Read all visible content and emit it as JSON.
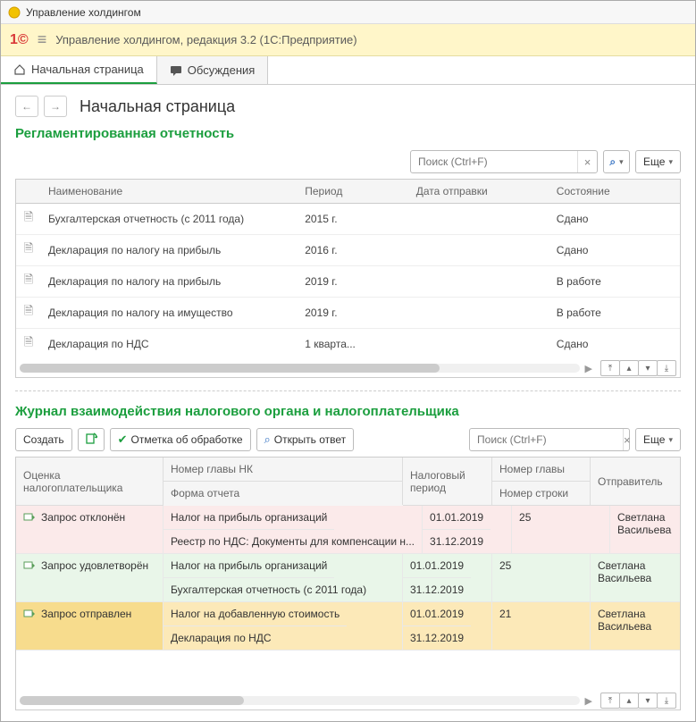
{
  "window_title": "Управление холдингом",
  "header_title": "Управление холдингом, редакция 3.2  (1С:Предприятие)",
  "tabs": {
    "home": "Начальная страница",
    "discussions": "Обсуждения"
  },
  "page_title": "Начальная страница",
  "section1": {
    "title": "Регламентированная отчетность",
    "search_placeholder": "Поиск (Ctrl+F)",
    "more_label": "Еще",
    "columns": {
      "name": "Наименование",
      "period": "Период",
      "sent_date": "Дата отправки",
      "status": "Состояние"
    },
    "rows": [
      {
        "name": "Бухгалтерская отчетность (с 2011 года)",
        "period": "2015 г.",
        "sent": "",
        "status": "Сдано"
      },
      {
        "name": "Декларация по налогу на прибыль",
        "period": "2016 г.",
        "sent": "",
        "status": "Сдано"
      },
      {
        "name": "Декларация по налогу на прибыль",
        "period": "2019 г.",
        "sent": "",
        "status": "В работе"
      },
      {
        "name": "Декларация по налогу на имущество",
        "period": "2019 г.",
        "sent": "",
        "status": "В работе"
      },
      {
        "name": "Декларация по НДС",
        "period": "1 кварта...",
        "sent": "",
        "status": "Сдано"
      }
    ]
  },
  "section2": {
    "title": "Журнал взаимодействия налогового органа и налогоплательщика",
    "btn_create": "Создать",
    "btn_mark": "Отметка об обработке",
    "btn_open": "Открыть ответ",
    "search_placeholder": "Поиск (Ctrl+F)",
    "more_label": "Еще",
    "columns": {
      "assessment": "Оценка налогоплательщика",
      "chapter": "Номер главы НК",
      "form": "Форма отчета",
      "tax_period": "Налоговый период",
      "chapter_num": "Номер главы",
      "line_num": "Номер строки",
      "sender": "Отправитель"
    },
    "rows": [
      {
        "css": "pink",
        "status": "Запрос отклонён",
        "chapter": "Налог на прибыль организаций",
        "form": "Реестр по НДС: Документы для компенсации н...",
        "period1": "01.01.2019",
        "period2": "31.12.2019",
        "num": "25",
        "sender": "Светлана Васильева"
      },
      {
        "css": "green",
        "status": "Запрос удовлетворён",
        "chapter": "Налог на прибыль организаций",
        "form": "Бухгалтерская отчетность (с 2011 года)",
        "period1": "01.01.2019",
        "period2": "31.12.2019",
        "num": "25",
        "sender": "Светлана Васильева"
      },
      {
        "css": "orange",
        "status": "Запрос отправлен",
        "chapter": "Налог на добавленную стоимость",
        "form": "Декларация по НДС",
        "period1": "01.01.2019",
        "period2": "31.12.2019",
        "num": "21",
        "sender": "Светлана Васильева"
      }
    ]
  }
}
